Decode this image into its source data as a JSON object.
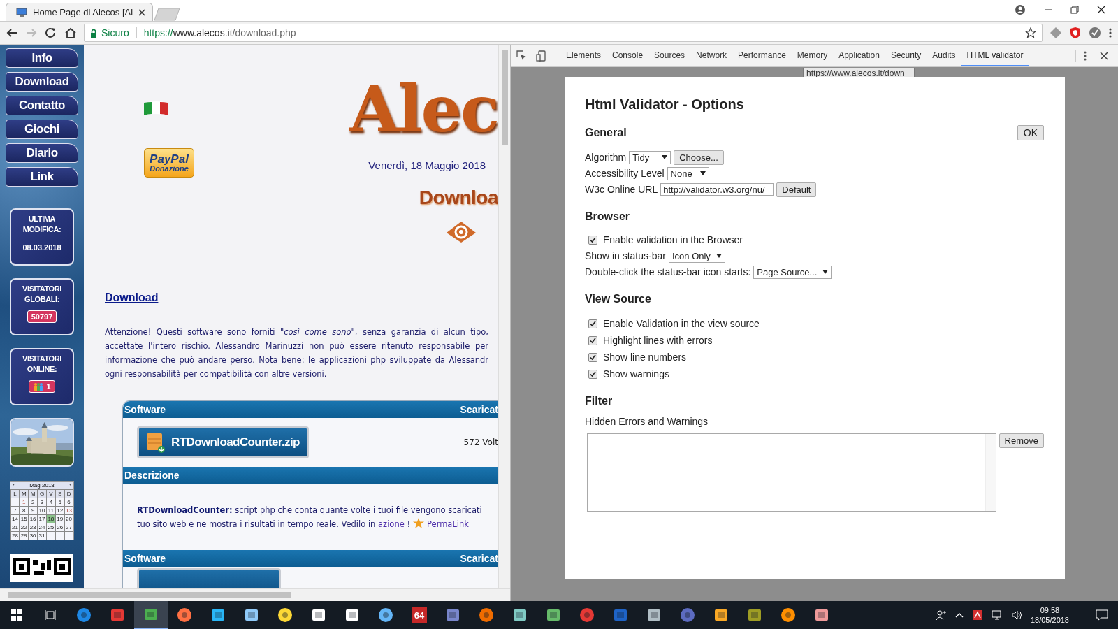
{
  "browser": {
    "tabs": [
      {
        "title": "Home Page di Alecos [Al",
        "selected": true
      }
    ],
    "security_label": "Sicuro",
    "url_scheme": "https://",
    "url_host": "www.alecos.it",
    "url_path": "/download.php"
  },
  "sidebar": {
    "nav": [
      "Info",
      "Download",
      "Contatto",
      "Giochi",
      "Diario",
      "Link"
    ],
    "boxes": [
      {
        "kind": "text",
        "title": "ULTIMA MODIFICA:",
        "value": "08.03.2018"
      },
      {
        "kind": "counter",
        "title": "VISITATORI GLOBALI:",
        "value": "50797"
      },
      {
        "kind": "online",
        "title": "VISITATORI ONLINE:",
        "value": "1"
      }
    ],
    "calendar": {
      "prev": "‹",
      "month": "Mag 2018",
      "next": "›",
      "weekdays": [
        "L",
        "M",
        "M",
        "G",
        "V",
        "S",
        "D"
      ],
      "weeks": [
        [
          {
            "day": "1",
            "selected": false,
            "holiday": true
          },
          {
            "day": "2",
            "selected": false,
            "holiday": false
          },
          {
            "day": "3",
            "selected": false,
            "holiday": false
          },
          {
            "day": "4",
            "selected": false,
            "holiday": false
          },
          {
            "day": "5",
            "selected": false,
            "holiday": false
          },
          {
            "day": "6",
            "selected": false,
            "holiday": false
          }
        ],
        [
          {
            "day": "7",
            "selected": false,
            "holiday": false
          },
          {
            "day": "8",
            "selected": false,
            "holiday": false
          },
          {
            "day": "9",
            "selected": false,
            "holiday": false
          },
          {
            "day": "10",
            "selected": false,
            "holiday": false
          },
          {
            "day": "11",
            "selected": false,
            "holiday": false
          },
          {
            "day": "12",
            "selected": false,
            "holiday": false
          },
          {
            "day": "13",
            "selected": false,
            "holiday": true
          }
        ],
        [
          {
            "day": "14",
            "selected": false,
            "holiday": false
          },
          {
            "day": "15",
            "selected": false,
            "holiday": false
          },
          {
            "day": "16",
            "selected": false,
            "holiday": false
          },
          {
            "day": "17",
            "selected": false,
            "holiday": false
          },
          {
            "day": "18",
            "selected": true,
            "holiday": false
          },
          {
            "day": "19",
            "selected": false,
            "holiday": false
          },
          {
            "day": "20",
            "selected": false,
            "holiday": false
          }
        ],
        [
          {
            "day": "21",
            "selected": false,
            "holiday": false
          },
          {
            "day": "22",
            "selected": false,
            "holiday": false
          },
          {
            "day": "23",
            "selected": false,
            "holiday": false
          },
          {
            "day": "24",
            "selected": false,
            "holiday": false
          },
          {
            "day": "25",
            "selected": false,
            "holiday": false
          },
          {
            "day": "26",
            "selected": false,
            "holiday": false
          },
          {
            "day": "27",
            "selected": false,
            "holiday": false
          }
        ],
        [
          {
            "day": "28",
            "selected": false,
            "holiday": false
          },
          {
            "day": "29",
            "selected": false,
            "holiday": false
          },
          {
            "day": "30",
            "selected": false,
            "holiday": false
          },
          {
            "day": "31",
            "selected": false,
            "holiday": false
          }
        ]
      ]
    }
  },
  "page": {
    "logo": "Alec",
    "paypal": "PayPal",
    "paypal_sub": "Donazione",
    "date": "Venerdì, 18 Maggio 2018",
    "section_title": "Downloa",
    "heading": "Download",
    "notice_lines": [
      "Attenzione! Questi software sono forniti *\"così come sono\"*, senza garanzia di alcun tipo,",
      "accettate l'intero rischio. Alessandro Marinuzzi non può essere ritenuto responsabile per",
      "informazione che può andare perso. Nota bene: le applicazioni php sviluppate da Alessandr",
      "ogni responsabilità per compatibilità con altre versioni."
    ],
    "downloads": [
      {
        "header_left": "Software",
        "header_right": "Scaricat",
        "file": "RTDownloadCounter.zip",
        "count": "572 Volt"
      },
      {
        "header_left": "Software",
        "header_right": "Scaricat"
      }
    ],
    "description": {
      "header": "Descrizione",
      "line1": "**RTDownloadCounter:** script php che conta quante volte i tuoi file vengono scaricati",
      "line2": "tuo sito web e ne mostra i risultati in tempo reale. Vedilo in",
      "link1": "azione",
      "after": "!",
      "link2": "PermaLink"
    }
  },
  "devtools": {
    "tabs": [
      {
        "label": "Elements",
        "selected": false
      },
      {
        "label": "Console",
        "selected": false
      },
      {
        "label": "Sources",
        "selected": false
      },
      {
        "label": "Network",
        "selected": false
      },
      {
        "label": "Performance",
        "selected": false
      },
      {
        "label": "Memory",
        "selected": false
      },
      {
        "label": "Application",
        "selected": false
      },
      {
        "label": "Security",
        "selected": false
      },
      {
        "label": "Audits",
        "selected": false
      },
      {
        "label": "HTML validator",
        "selected": true
      }
    ],
    "behind_url": "https://www.alecos.it/down",
    "options": {
      "title": "Html Validator - Options",
      "ok": "OK",
      "sections": [
        {
          "title": "General",
          "rows": [
            {
              "kind": "select",
              "label": "Algorithm",
              "value": "Tidy",
              "button": "Choose..."
            },
            {
              "kind": "select",
              "label": "Accessibility Level",
              "value": "None"
            },
            {
              "kind": "input",
              "label": "W3c Online URL",
              "value": "http://validator.w3.org/nu/",
              "button": "Default"
            }
          ]
        },
        {
          "title": "Browser",
          "rows": [
            {
              "kind": "checkbox",
              "label": "Enable validation in the Browser",
              "checked": true
            },
            {
              "kind": "select",
              "label": "Show in status-bar",
              "value": "Icon Only"
            },
            {
              "kind": "select",
              "label": "Double-click the status-bar icon starts:",
              "value": "Page Source..."
            }
          ]
        },
        {
          "title": "View Source",
          "rows": [
            {
              "kind": "checkbox",
              "label": "Enable Validation in the view source",
              "checked": true
            },
            {
              "kind": "checkbox",
              "label": "Highlight lines with errors",
              "checked": true
            },
            {
              "kind": "checkbox",
              "label": "Show line numbers",
              "checked": true
            },
            {
              "kind": "checkbox",
              "label": "Show warnings",
              "checked": true
            }
          ]
        },
        {
          "title": "Filter",
          "rows": [
            {
              "kind": "list",
              "label": "Hidden Errors and Warnings",
              "button": "Remove"
            }
          ]
        }
      ]
    }
  },
  "taskbar": {
    "app_label": "64",
    "time": "09:58",
    "date": "18/05/2018"
  }
}
